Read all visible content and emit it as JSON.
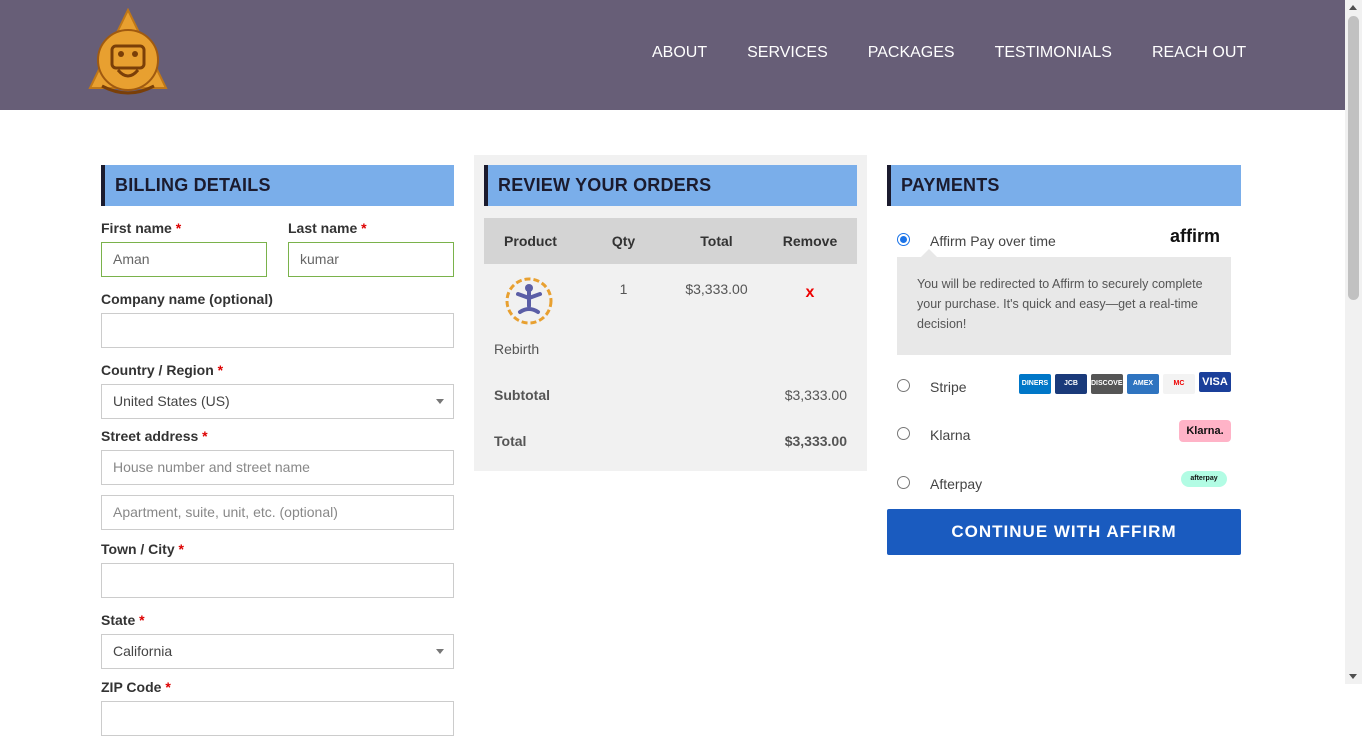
{
  "header": {
    "nav": [
      "ABOUT",
      "SERVICES",
      "PACKAGES",
      "TESTIMONIALS",
      "REACH OUT"
    ],
    "bg_color": "#675e77"
  },
  "billing": {
    "title": "BILLING DETAILS",
    "first_name_label": "First name",
    "first_name_value": "Aman",
    "last_name_label": "Last name",
    "last_name_value": "kumar",
    "company_label": "Company name (optional)",
    "company_value": "",
    "country_label": "Country / Region",
    "country_value": "United States (US)",
    "street_label": "Street address",
    "street_placeholder": "House number and street name",
    "apt_placeholder": "Apartment, suite, unit, etc. (optional)",
    "city_label": "Town / City",
    "city_value": "",
    "state_label": "State",
    "state_value": "California",
    "zip_label": "ZIP Code",
    "required_mark": "*"
  },
  "review": {
    "title": "REVIEW YOUR ORDERS",
    "columns": [
      "Product",
      "Qty",
      "Total",
      "Remove"
    ],
    "item": {
      "name": "Rebirth",
      "qty": "1",
      "total": "$3,333.00",
      "remove": "x"
    },
    "subtotal_label": "Subtotal",
    "subtotal_value": "$3,333.00",
    "total_label": "Total",
    "total_value": "$3,333.00"
  },
  "payments": {
    "title": "PAYMENTS",
    "options": [
      {
        "label": "Affirm Pay over time",
        "selected": true,
        "brand": "affirm"
      },
      {
        "label": "Stripe",
        "selected": false
      },
      {
        "label": "Klarna",
        "selected": false,
        "brand": "Klarna."
      },
      {
        "label": "Afterpay",
        "selected": false,
        "brand": "afterpay"
      }
    ],
    "affirm_message": "You will be redirected to Affirm to securely complete your purchase. It's quick and easy—get a real-time decision!",
    "cards": [
      "DINERS",
      "JCB",
      "DISCOVER",
      "AMEX",
      "MC",
      "VISA"
    ],
    "continue_label": "CONTINUE WITH AFFIRM",
    "accent_color": "#1a5bbf"
  }
}
